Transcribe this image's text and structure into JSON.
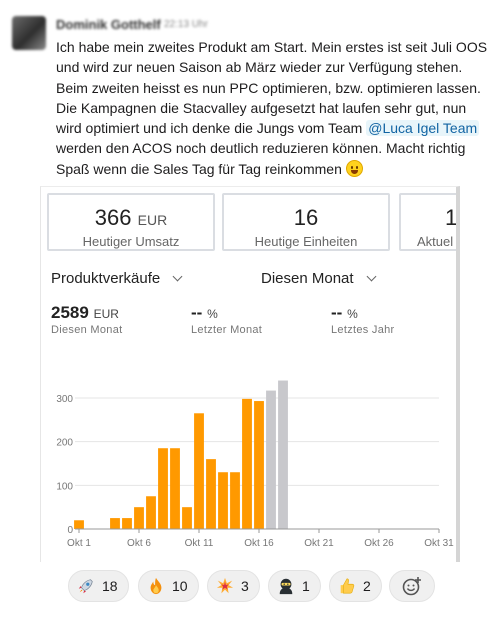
{
  "author": "Dominik Gotthelf",
  "time": "22:13 Uhr",
  "message": {
    "text_before": "Ich habe mein zweites Produkt am Start. Mein erstes ist seit Juli OOS und wird zur neuen Saison ab März wieder zur Verfügung stehen. Beim zweiten heisst es nun PPC optimieren, bzw. optimieren lassen. Die Kampagnen die Stacvalley aufgesetzt hat laufen sehr gut, nun wird optimiert und ich denke die Jungs vom Team ",
    "mention": "@Luca Igel Team",
    "text_after": " werden den ACOS noch deutlich reduzieren können. Macht richtig Spaß wenn die Sales Tag für Tag reinkommen",
    "emoji": "grinning-face-emoji"
  },
  "stats": [
    {
      "value": "366",
      "unit": "EUR",
      "label": "Heutiger Umsatz"
    },
    {
      "value": "16",
      "unit": "",
      "label": "Heutige Einheiten"
    },
    {
      "value": "1",
      "unit": "",
      "label": "Aktuel"
    }
  ],
  "selectors": {
    "metric": "Produktverkäufe",
    "period": "Diesen Monat"
  },
  "metrics": [
    {
      "value": "2589",
      "unit": "EUR",
      "label": "Diesen Monat"
    },
    {
      "value": "--",
      "unit": "%",
      "label": "Letzter Monat"
    },
    {
      "value": "--",
      "unit": "%",
      "label": "Letztes Jahr"
    }
  ],
  "chart_data": {
    "type": "bar",
    "x": [
      "Okt 1",
      "Okt 2",
      "Okt 3",
      "Okt 4",
      "Okt 5",
      "Okt 6",
      "Okt 7",
      "Okt 8",
      "Okt 9",
      "Okt 10",
      "Okt 11",
      "Okt 12",
      "Okt 13",
      "Okt 14",
      "Okt 15",
      "Okt 16",
      "Okt 17",
      "Okt 18"
    ],
    "values": [
      20,
      0,
      0,
      25,
      25,
      50,
      75,
      185,
      185,
      50,
      265,
      160,
      130,
      130,
      298,
      293,
      317,
      340
    ],
    "projected_from_index": 16,
    "xticks": [
      "Okt 1",
      "Okt 6",
      "Okt 11",
      "Okt 16",
      "Okt 21",
      "Okt 26",
      "Okt 31"
    ],
    "yticks": [
      0,
      100,
      200,
      300
    ],
    "ylim": [
      0,
      330
    ],
    "x_range_days": [
      1,
      31
    ],
    "colors": {
      "bar": "#ff9900",
      "projected": "#c8c8cc",
      "grid": "#e4e4e4",
      "axis": "#999999"
    }
  },
  "reactions": [
    {
      "icon": "rocket-icon",
      "count": "18"
    },
    {
      "icon": "fire-icon",
      "count": "10"
    },
    {
      "icon": "collision-icon",
      "count": "3"
    },
    {
      "icon": "ninja-icon",
      "count": "1"
    },
    {
      "icon": "thumbs-up-icon",
      "count": "2"
    },
    {
      "icon": "add-reaction-icon",
      "count": ""
    }
  ]
}
